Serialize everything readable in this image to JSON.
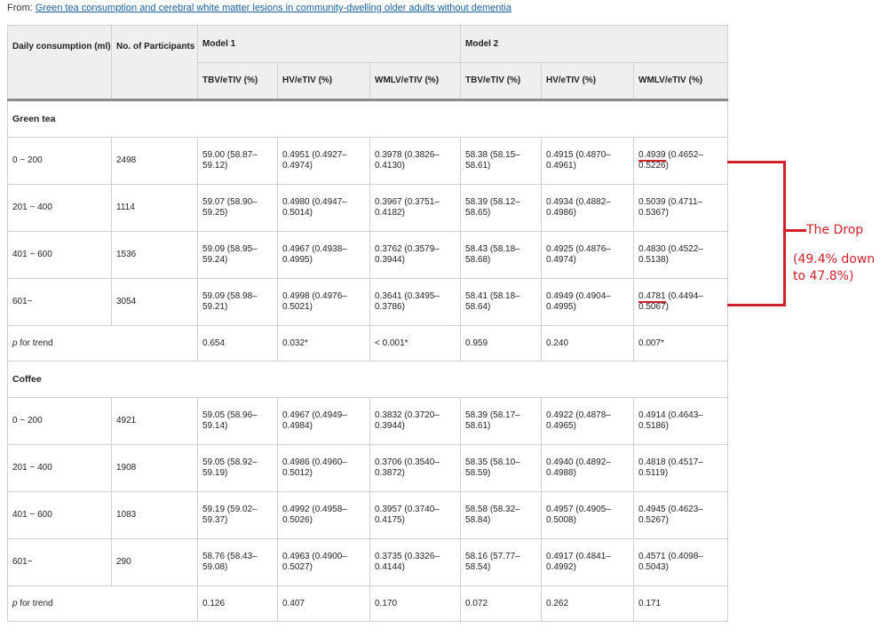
{
  "source": {
    "prefix": "From:",
    "link_text": "Green tea consumption and cerebral white matter lesions in community-dwelling older adults without dementia"
  },
  "table": {
    "headers": {
      "consumption": "Daily consumption (ml)",
      "participants": "No. of Participants",
      "model1": "Model 1",
      "model2": "Model 2",
      "sub": [
        "TBV/eTIV (%)",
        "HV/eTIV (%)",
        "WMLV/eTIV (%)",
        "TBV/eTIV (%)",
        "HV/eTIV (%)",
        "WMLV/eTIV (%)"
      ]
    },
    "sections": [
      {
        "title": "Green tea",
        "rows": [
          {
            "consumption": "0 ~ 200",
            "n": "2498",
            "cells": [
              "59.00 (58.87–59.12)",
              "0.4951 (0.4927–0.4974)",
              "0.3978 (0.3826–0.4130)",
              "58.38 (58.15–58.61)",
              "0.4915 (0.4870–0.4961)",
              "(0.4652–0.5226)"
            ],
            "highlight_value": "0.4939"
          },
          {
            "consumption": "201 ~ 400",
            "n": "1114",
            "cells": [
              "59.07 (58.90–59.25)",
              "0.4980 (0.4947–0.5014)",
              "0.3967 (0.3751–0.4182)",
              "58.39 (58.12–58.65)",
              "0.4934 (0.4882–0.4986)",
              "0.5039 (0.4711–0.5367)"
            ]
          },
          {
            "consumption": "401 ~ 600",
            "n": "1536",
            "cells": [
              "59.09 (58.95–59.24)",
              "0.4967 (0.4938–0.4995)",
              "0.3762 (0.3579–0.3944)",
              "58.43 (58.18–58.68)",
              "0.4925 (0.4876–0.4974)",
              "0.4830 (0.4522–0.5138)"
            ]
          },
          {
            "consumption": "601~",
            "n": "3054",
            "cells": [
              "59.09 (58.98–59.21)",
              "0.4998 (0.4976–0.5021)",
              "0.3641 (0.3495–0.3786)",
              "58.41 (58.18–58.64)",
              "0.4949 (0.4904–0.4995)",
              "(0.4494–0.5067)"
            ],
            "highlight_value": "0.4781"
          }
        ],
        "trend": {
          "label_p": "p",
          "label_rest": " for trend",
          "cells": [
            "0.654",
            "0.032*",
            "< 0.001*",
            "0.959",
            "0.240",
            "0.007*"
          ]
        }
      },
      {
        "title": "Coffee",
        "rows": [
          {
            "consumption": "0 ~ 200",
            "n": "4921",
            "cells": [
              "59.05 (58.96–59.14)",
              "0.4967 (0.4949–0.4984)",
              "0.3832 (0.3720–0.3944)",
              "58.39 (58.17–58.61)",
              "0.4922 (0.4878–0.4965)",
              "0.4914 (0.4643–0.5186)"
            ]
          },
          {
            "consumption": "201 ~ 400",
            "n": "1908",
            "cells": [
              "59.05 (58.92–59.19)",
              "0.4986 (0.4960–0.5012)",
              "0.3706 (0.3540–0.3872)",
              "58.35 (58.10–58.59)",
              "0.4940 (0.4892–0.4988)",
              "0.4818 (0.4517–0.5119)"
            ]
          },
          {
            "consumption": "401 ~ 600",
            "n": "1083",
            "cells": [
              "59.19 (59.02–59.37)",
              "0.4992 (0.4958–0.5026)",
              "0.3957 (0.3740–0.4175)",
              "58.58 (58.32–58.84)",
              "0.4957 (0.4905–0.5008)",
              "0.4945 (0.4623–0.5267)"
            ]
          },
          {
            "consumption": "601~",
            "n": "290",
            "cells": [
              "58.76 (58.43–59.08)",
              "0.4963 (0.4900–0.5027)",
              "0.3735 (0.3326–0.4144)",
              "58.16 (57.77–58.54)",
              "0.4917 (0.4841–0.4992)",
              "0.4571 (0.4098–0.5043)"
            ]
          }
        ],
        "trend": {
          "label_p": "p",
          "label_rest": " for trend",
          "cells": [
            "0.126",
            "0.407",
            "0.170",
            "0.072",
            "0.262",
            "0.171"
          ]
        }
      }
    ]
  },
  "annotation": {
    "title": "The Drop",
    "line1": "(49.4% down",
    "line2": "to 47.8%)",
    "color": "#d0212b"
  }
}
